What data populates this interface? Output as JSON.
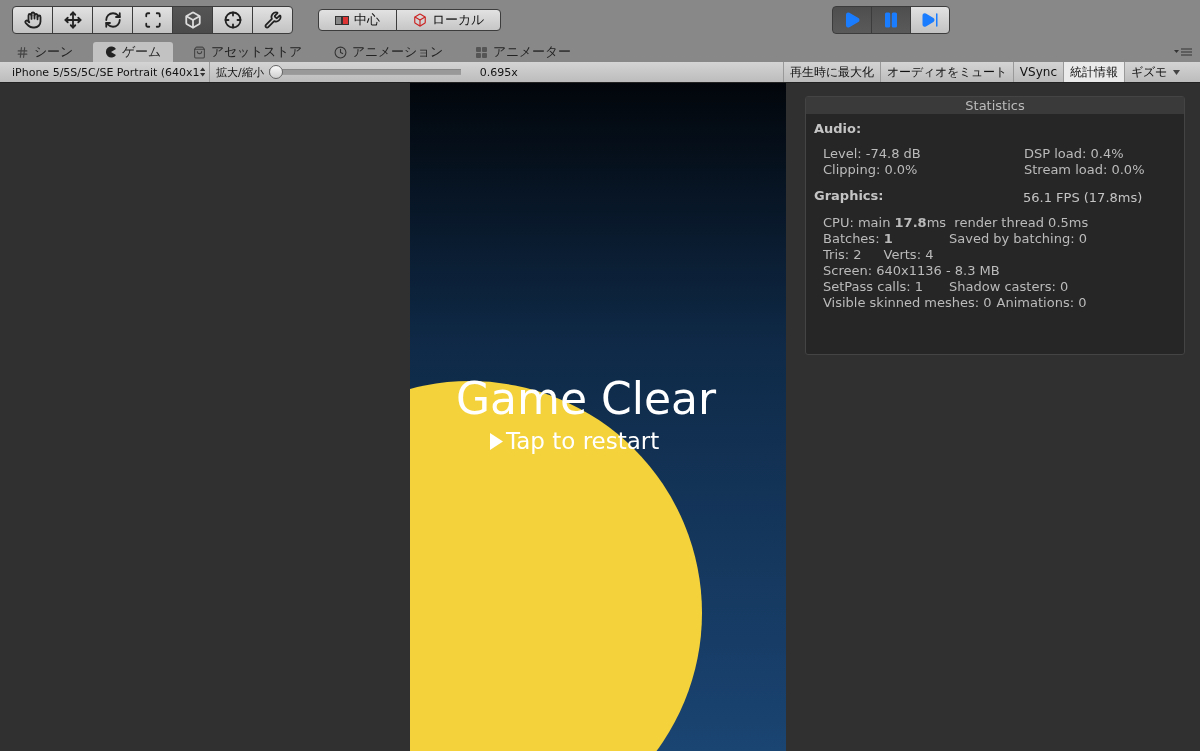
{
  "toolbar": {
    "tools": [
      {
        "kind": "hand",
        "selected": false
      },
      {
        "kind": "move",
        "selected": false
      },
      {
        "kind": "rotate",
        "selected": false
      },
      {
        "kind": "scale",
        "selected": false
      },
      {
        "kind": "rect",
        "selected": true
      },
      {
        "kind": "transform",
        "selected": false
      },
      {
        "kind": "custom",
        "selected": false
      }
    ],
    "pivot": [
      {
        "kind": "pivot",
        "label": "中心"
      },
      {
        "kind": "space",
        "label": "ローカル"
      }
    ],
    "playback": [
      {
        "kind": "play",
        "on": true
      },
      {
        "kind": "pause",
        "on": true
      },
      {
        "kind": "step",
        "on": false
      }
    ]
  },
  "tabs": [
    {
      "kind": "scene",
      "label": "シーン",
      "selected": false
    },
    {
      "kind": "game",
      "label": "ゲーム",
      "selected": true
    },
    {
      "kind": "store",
      "label": "アセットストア",
      "selected": false
    },
    {
      "kind": "animation",
      "label": "アニメーション",
      "selected": false
    },
    {
      "kind": "animator",
      "label": "アニメーター",
      "selected": false
    }
  ],
  "game_bar": {
    "resolution": "iPhone 5/5S/5C/SE Portrait (640x1",
    "scale_label": "拡大/縮小",
    "scale": {
      "level": 0
    },
    "scale_value": "0.695x",
    "toggles": [
      {
        "label": "再生時に最大化",
        "on": false
      },
      {
        "label": "オーディオをミュート",
        "on": false
      },
      {
        "label": "VSync",
        "on": false
      },
      {
        "label": "統計情報",
        "on": true
      },
      {
        "label": "ギズモ",
        "on": false,
        "dropdown": true
      }
    ]
  },
  "game_view": {
    "title": "Game Clear",
    "prompt": "Tap to restart"
  },
  "statistics": {
    "title": "Statistics",
    "audio_heading": "Audio:",
    "audio": [
      [
        "Level: -74.8 dB",
        "DSP load: 0.4%"
      ],
      [
        "Clipping: 0.0%",
        "Stream load: 0.0%"
      ]
    ],
    "graphics_heading": "Graphics:",
    "fps": "56.1 FPS (17.8ms)",
    "graphics": [
      {
        "kind": "single",
        "cells": [
          "CPU: main **17.8**ms  render thread 0.5ms"
        ]
      },
      {
        "kind": "columns",
        "cells": [
          "Batches: **1**",
          "Saved by batching: 0"
        ]
      },
      {
        "kind": "inline",
        "cells": [
          "Tris: 2",
          "Verts: 4"
        ]
      },
      {
        "kind": "single",
        "cells": [
          "Screen: 640x1136 - 8.3 MB"
        ]
      },
      {
        "kind": "columns",
        "cells": [
          "SetPass calls: 1",
          "Shadow casters: 0"
        ]
      },
      {
        "kind": "inline",
        "cells": [
          "Visible skinned meshes: 0",
          "Animations: 0"
        ]
      }
    ]
  }
}
